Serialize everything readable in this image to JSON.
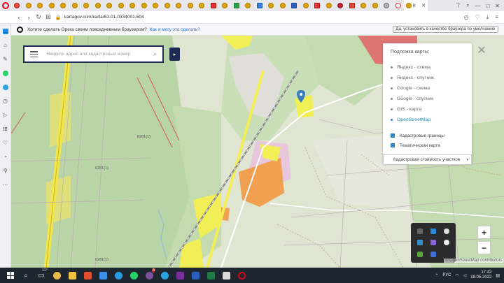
{
  "browser": {
    "active_tab": {
      "label": "К",
      "close": "✕"
    },
    "window_controls": {
      "pin": "⊤",
      "search": "⌕",
      "minimize": "—",
      "maximize": "□",
      "close": "✕"
    },
    "nav": {
      "back": "‹",
      "forward": "›",
      "reload": "↻",
      "speed_dial": "⊞"
    },
    "url": "kartagov.com/karta/63-01-0334001-504"
  },
  "promo": {
    "text": "Хотите сделать Opera своим повседневным браузером?",
    "link": "Как я могу это сделать?",
    "button": "Да, установить в качестве браузера по умолчанию"
  },
  "search": {
    "placeholder": "Введите адрес или кадастровый номер",
    "expand": "▸"
  },
  "layers": {
    "title": "Подложка карты:",
    "basemaps": [
      {
        "label": "Яндекс - схема",
        "selected": false
      },
      {
        "label": "Яндекс - спутник",
        "selected": false
      },
      {
        "label": "Google - схема",
        "selected": false
      },
      {
        "label": "Google - спутник",
        "selected": false
      },
      {
        "label": "GIS - карта",
        "selected": false
      },
      {
        "label": "OpenStreetMap",
        "selected": true
      }
    ],
    "overlays": [
      {
        "label": "Кадастровые границы",
        "checked": true
      },
      {
        "label": "Тематическая карта",
        "checked": true
      }
    ],
    "thematic_select": "Кадастровая стоимость участков",
    "select_arrow": "▾"
  },
  "map": {
    "labels": [
      "6281(1)",
      "6281(1)",
      "6281(1)"
    ],
    "close": "✕",
    "zoom_in": "+",
    "zoom_out": "−",
    "attribution": "© OpenStreetMap contributors"
  },
  "taskbar": {
    "weather": "11°",
    "badge": "5",
    "tray_lang": "РУС",
    "tray_arrow": "⌃",
    "time": "17:42",
    "date": "18.05.2022"
  },
  "colors": {
    "accent_navy": "#1d2b54",
    "opera_red": "#e0001b",
    "selected_blue": "#2a8ab5",
    "checkbox_blue": "#2e86c1",
    "parcel_orange": "#f0a050",
    "parcel_yellow": "#f2ee55",
    "forest_green": "#c4dbb2"
  }
}
